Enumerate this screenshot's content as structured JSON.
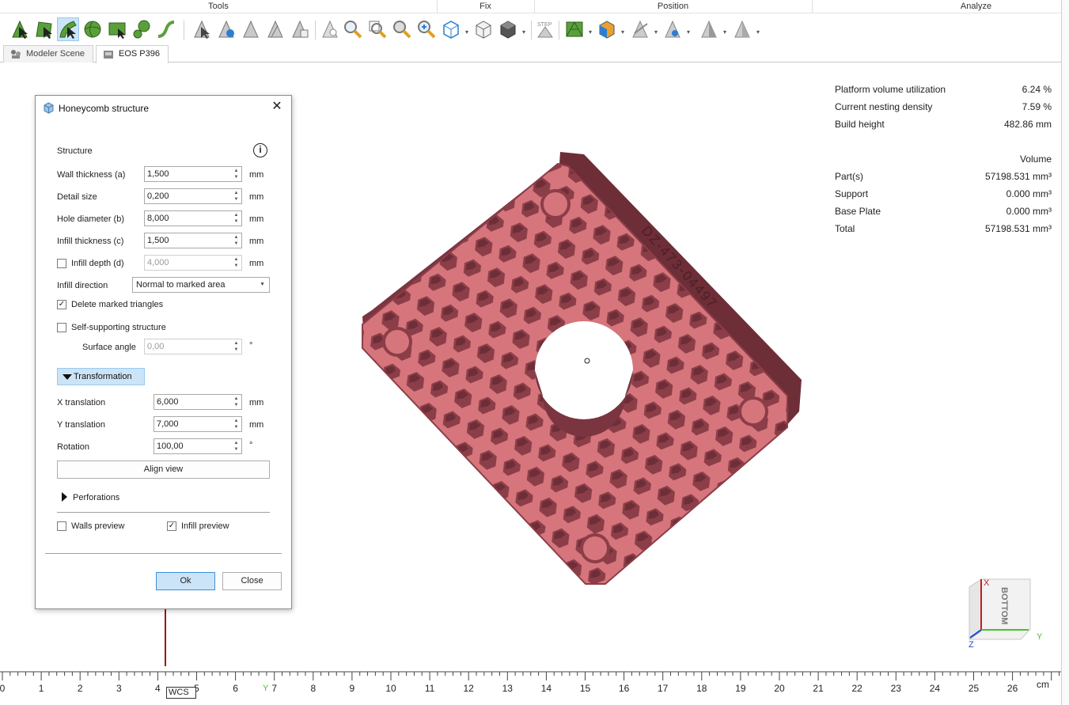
{
  "ribbon": {
    "groups": [
      "Tools",
      "Fix",
      "Position",
      "Analyze"
    ]
  },
  "toolbar": {
    "icons": [
      "select-triangle-icon",
      "select-surface-icon",
      "select-shell-icon",
      "select-sphere-icon",
      "select-rectangle-icon",
      "select-connected-icon",
      "select-curve-icon",
      "invert-selection-icon",
      "shell-selection-icon",
      "deselect-icon",
      "grow-selection-icon",
      "shrink-selection-icon",
      "mark-icon",
      "zoom-icon",
      "zoom-box-icon",
      "zoom-part-icon",
      "zoom-all-icon",
      "view-box-icon",
      "view-cube-icon",
      "solid-view-icon",
      "step-icon",
      "mesh-view-icon",
      "color-view-icon",
      "measure-icon",
      "section-icon",
      "shading-icon",
      "shading-dropdown-icon"
    ]
  },
  "tabs": [
    {
      "label": "Modeler Scene",
      "active": false
    },
    {
      "label": "EOS P396",
      "active": true
    }
  ],
  "info": {
    "rows": [
      {
        "label": "Platform volume utilization",
        "value": "6.24 %"
      },
      {
        "label": "Current nesting density",
        "value": "7.59 %"
      },
      {
        "label": "Build height",
        "value": "482.86 mm"
      }
    ],
    "volume_header": "Volume",
    "volumes": [
      {
        "label": "Part(s)",
        "value": "57198.531 mm³"
      },
      {
        "label": "Support",
        "value": "0.000 mm³"
      },
      {
        "label": "Base Plate",
        "value": "0.000 mm³"
      },
      {
        "label": "Total",
        "value": "57198.531 mm³"
      }
    ]
  },
  "dialog": {
    "title": "Honeycomb structure",
    "close": "✕",
    "structure_label": "Structure",
    "info_icon": "i",
    "wall_thickness": {
      "label": "Wall thickness (a)",
      "value": "1,500",
      "unit": "mm"
    },
    "detail_size": {
      "label": "Detail size",
      "value": "0,200",
      "unit": "mm"
    },
    "hole_diameter": {
      "label": "Hole diameter (b)",
      "value": "8,000",
      "unit": "mm"
    },
    "infill_thickness": {
      "label": "Infill thickness (c)",
      "value": "1,500",
      "unit": "mm"
    },
    "infill_depth": {
      "label": "Infill depth (d)",
      "value": "4,000",
      "unit": "mm",
      "checked": false
    },
    "infill_direction": {
      "label": "Infill direction",
      "value": "Normal to marked area"
    },
    "delete_marked": {
      "label": "Delete marked triangles",
      "checked": true
    },
    "self_supporting": {
      "label": "Self-supporting structure",
      "checked": false
    },
    "surface_angle": {
      "label": "Surface angle",
      "value": "0,00",
      "unit": "°"
    },
    "transformation_label": "Transformation",
    "x_translation": {
      "label": "X translation",
      "value": "6,000",
      "unit": "mm"
    },
    "y_translation": {
      "label": "Y translation",
      "value": "7,000",
      "unit": "mm"
    },
    "rotation": {
      "label": "Rotation",
      "value": "100,00",
      "unit": "°"
    },
    "align_view": "Align view",
    "perforations_label": "Perforations",
    "walls_preview": {
      "label": "Walls preview",
      "checked": false
    },
    "infill_preview": {
      "label": "Infill preview",
      "checked": true
    },
    "ok": "Ok",
    "close_button": "Close"
  },
  "part": {
    "engraving": "DZ-473-04497",
    "color": "#d6757c"
  },
  "view_cube": {
    "face_label": "BOTTOM",
    "x_axis": "X",
    "y_axis": "Y",
    "z_axis": "Z"
  },
  "ruler": {
    "ticks": [
      "0",
      "1",
      "2",
      "3",
      "4",
      "5",
      "6",
      "7",
      "8",
      "9",
      "10",
      "11",
      "12",
      "13",
      "14",
      "15",
      "16",
      "17",
      "18",
      "19",
      "20",
      "21",
      "22",
      "23",
      "24",
      "25",
      "26"
    ],
    "unit": "cm"
  },
  "wcs": {
    "label": "WCS",
    "y_axis": "Y"
  }
}
